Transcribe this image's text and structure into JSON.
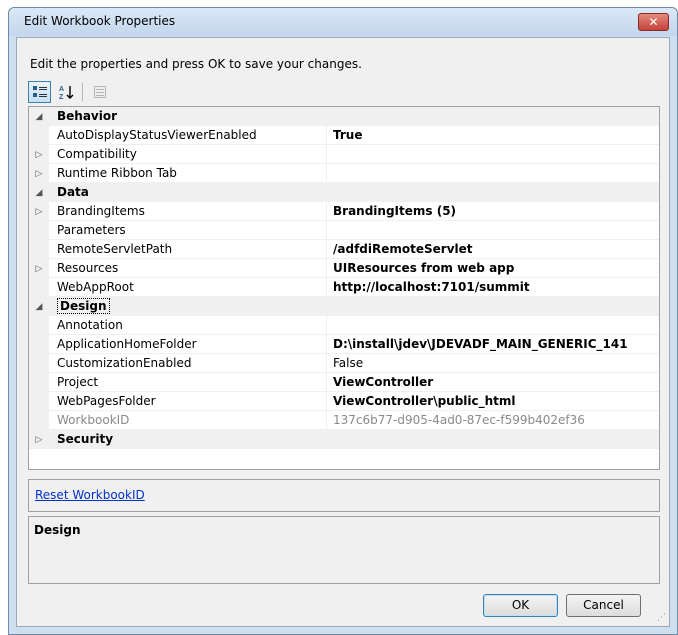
{
  "window": {
    "title": "Edit Workbook Properties",
    "close_glyph": "✕"
  },
  "instructions": "Edit the properties and press OK to save your changes.",
  "toolbar": {
    "categorized_icon": "categorized-icon",
    "alphabetical_icon": "sort-alphabetical-icon",
    "property_pages_icon": "property-pages-icon"
  },
  "grid": {
    "rows": [
      {
        "type": "category",
        "label": "Behavior",
        "expander": "◢"
      },
      {
        "type": "prop",
        "name": "AutoDisplayStatusViewerEnabled",
        "value": "True",
        "bold": true,
        "expander": ""
      },
      {
        "type": "prop",
        "name": "Compatibility",
        "value": "",
        "bold": false,
        "expander": "▷"
      },
      {
        "type": "prop",
        "name": "Runtime Ribbon Tab",
        "value": "",
        "bold": false,
        "expander": "▷"
      },
      {
        "type": "category",
        "label": "Data",
        "expander": "◢"
      },
      {
        "type": "prop",
        "name": "BrandingItems",
        "value": "BrandingItems (5)",
        "bold": true,
        "expander": "▷"
      },
      {
        "type": "prop",
        "name": "Parameters",
        "value": "",
        "bold": false,
        "expander": ""
      },
      {
        "type": "prop",
        "name": "RemoteServletPath",
        "value": "/adfdiRemoteServlet",
        "bold": true,
        "expander": ""
      },
      {
        "type": "prop",
        "name": "Resources",
        "value": "UIResources from web app",
        "bold": true,
        "expander": "▷"
      },
      {
        "type": "prop",
        "name": "WebAppRoot",
        "value": "http://localhost:7101/summit",
        "bold": true,
        "expander": ""
      },
      {
        "type": "category",
        "label": "Design",
        "expander": "◢",
        "selected": true
      },
      {
        "type": "prop",
        "name": "Annotation",
        "value": "",
        "bold": false,
        "expander": ""
      },
      {
        "type": "prop",
        "name": "ApplicationHomeFolder",
        "value": "D:\\install\\jdev\\JDEVADF_MAIN_GENERIC_141",
        "bold": true,
        "expander": ""
      },
      {
        "type": "prop",
        "name": "CustomizationEnabled",
        "value": "False",
        "bold": false,
        "expander": ""
      },
      {
        "type": "prop",
        "name": "Project",
        "value": "ViewController",
        "bold": true,
        "expander": ""
      },
      {
        "type": "prop",
        "name": "WebPagesFolder",
        "value": "ViewController\\public_html",
        "bold": true,
        "expander": ""
      },
      {
        "type": "prop",
        "name": "WorkbookID",
        "value": "137c6b77-d905-4ad0-87ec-f599b402ef36",
        "bold": false,
        "grey": true,
        "expander": ""
      },
      {
        "type": "category",
        "label": "Security",
        "expander": "▷"
      }
    ]
  },
  "commands": {
    "reset_link": "Reset WorkbookID"
  },
  "description": {
    "title": "Design"
  },
  "buttons": {
    "ok": "OK",
    "cancel": "Cancel"
  }
}
